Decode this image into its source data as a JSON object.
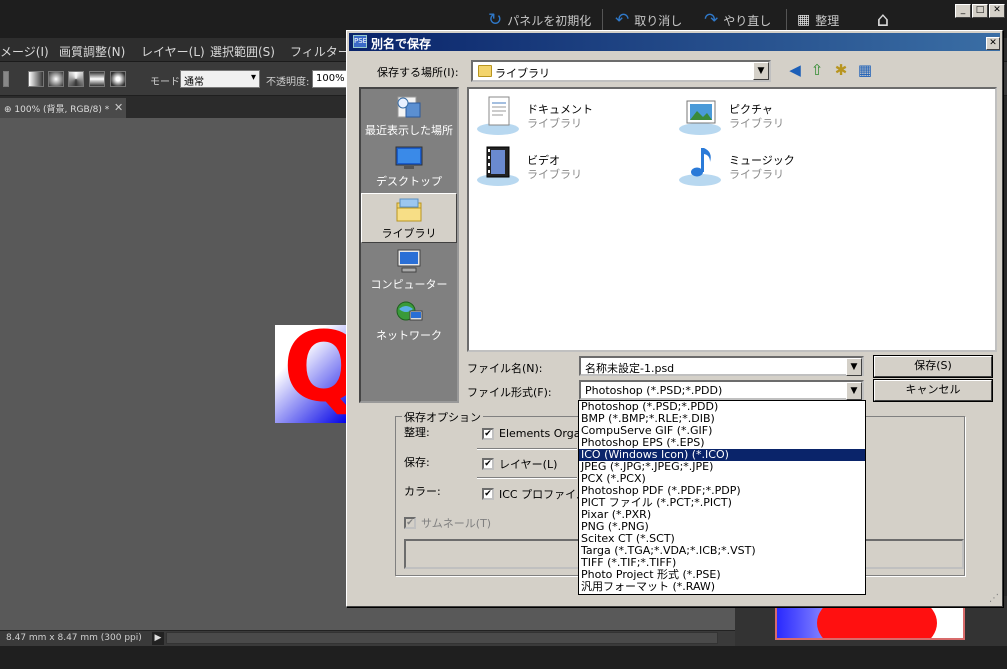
{
  "app": {
    "toolbar": {
      "reset_panels": "パネルを初期化",
      "undo": "取り消し",
      "redo": "やり直し",
      "organize": "整理"
    },
    "menu": [
      "メージ(I)",
      "画質調整(N)",
      "レイヤー(L)",
      "選択範囲(S)",
      "フィルター(T"
    ],
    "options": {
      "mode_label": "モード",
      "mode_value": "通常",
      "opacity_label": "不透明度:",
      "opacity_value": "100%"
    },
    "doc_tab": "100% (背景, RGB/8) *",
    "status_text": "8.47 mm x 8.47 mm (300 ppi)",
    "artwork_letter": "Q"
  },
  "dialog": {
    "title": "別名で保存",
    "title_icon": "PSE",
    "save_in_label": "保存する場所(I):",
    "save_in_value": "ライブラリ",
    "places": [
      {
        "label": "最近表示した場所",
        "icon": "recent-places-icon"
      },
      {
        "label": "デスクトップ",
        "icon": "desktop-icon"
      },
      {
        "label": "ライブラリ",
        "icon": "libraries-icon",
        "selected": true
      },
      {
        "label": "コンピューター",
        "icon": "computer-icon"
      },
      {
        "label": "ネットワーク",
        "icon": "network-icon"
      }
    ],
    "libraries": [
      {
        "name": "ドキュメント",
        "sub": "ライブラリ",
        "icon": "documents-icon"
      },
      {
        "name": "ピクチャ",
        "sub": "ライブラリ",
        "icon": "pictures-icon"
      },
      {
        "name": "ビデオ",
        "sub": "ライブラリ",
        "icon": "videos-icon"
      },
      {
        "name": "ミュージック",
        "sub": "ライブラリ",
        "icon": "music-icon"
      }
    ],
    "filename_label": "ファイル名(N):",
    "filename_value": "名称未設定-1.psd",
    "filetype_label": "ファイル形式(F):",
    "filetype_value": "Photoshop (*.PSD;*.PDD)",
    "save_button": "保存(S)",
    "cancel_button": "キャンセル",
    "options_legend": "保存オプション",
    "organize_label": "整理:",
    "organize_option": "Elements Organ",
    "save_label": "保存:",
    "layers_option": "レイヤー(L)",
    "color_label": "カラー:",
    "icc_option": "ICC プロファイル(",
    "thumbnail_option": "サムネール(T)",
    "filetype_options": [
      "Photoshop (*.PSD;*.PDD)",
      "BMP (*.BMP;*.RLE;*.DIB)",
      "CompuServe GIF (*.GIF)",
      "Photoshop EPS (*.EPS)",
      "ICO (Windows Icon) (*.ICO)",
      "JPEG (*.JPG;*.JPEG;*.JPE)",
      "PCX (*.PCX)",
      "Photoshop PDF (*.PDF;*.PDP)",
      "PICT ファイル (*.PCT;*.PICT)",
      "Pixar (*.PXR)",
      "PNG (*.PNG)",
      "Scitex CT (*.SCT)",
      "Targa (*.TGA;*.VDA;*.ICB;*.VST)",
      "TIFF (*.TIF;*.TIFF)",
      "Photo Project 形式 (*.PSE)",
      "汎用フォーマット (*.RAW)"
    ],
    "filetype_selected_index": 4
  },
  "colors": {
    "titlebar": "#0a246a",
    "highlight": "#0a246a",
    "dialog_face": "#d4d0c8",
    "artwork_red": "#ff0000",
    "artwork_blue": "#0000e6"
  }
}
